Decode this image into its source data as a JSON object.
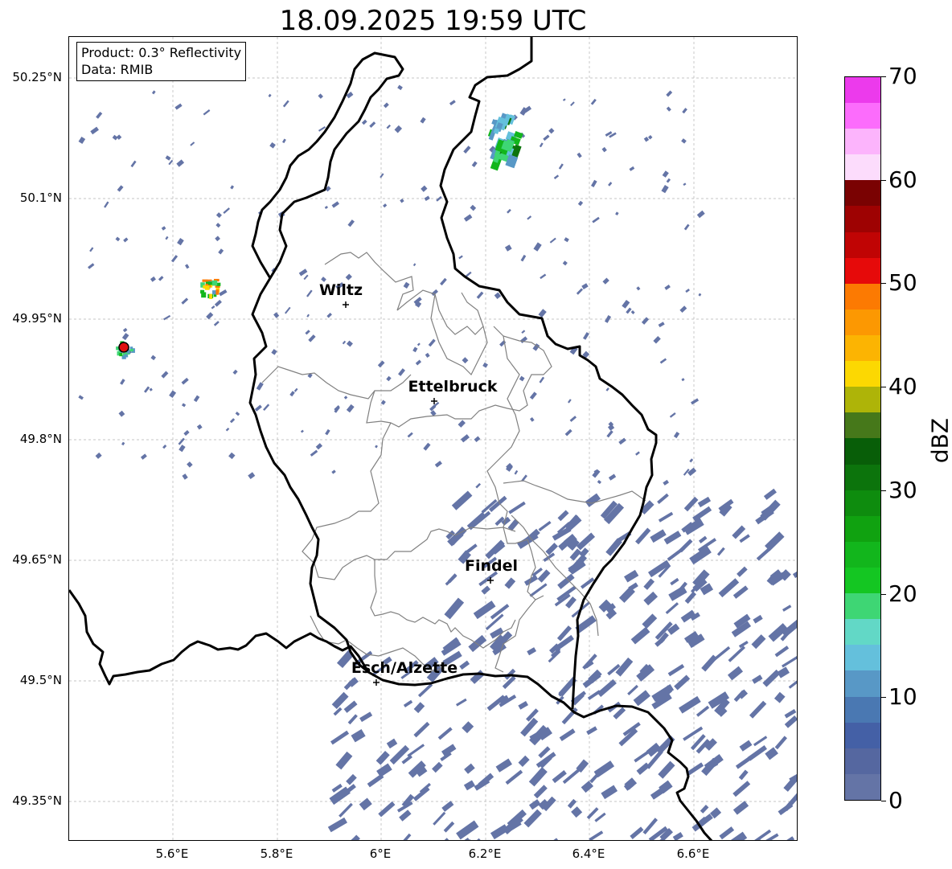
{
  "title": "18.09.2025 19:59 UTC",
  "info": {
    "product": "Product: 0.3° Reflectivity",
    "data": "Data: RMIB"
  },
  "latitude_labels": [
    "50.25°N",
    "50.1°N",
    "49.95°N",
    "49.8°N",
    "49.65°N",
    "49.5°N",
    "49.35°N"
  ],
  "longitude_labels": [
    "5.6°E",
    "5.8°E",
    "6°E",
    "6.2°E",
    "6.4°E",
    "6.6°E"
  ],
  "cities": [
    {
      "name": "Wiltz"
    },
    {
      "name": "Ettelbruck"
    },
    {
      "name": "Findel"
    },
    {
      "name": "Esch/Alzette"
    }
  ],
  "colorbar": {
    "unit": "dBZ",
    "tick_labels": [
      "0",
      "10",
      "20",
      "30",
      "40",
      "50",
      "60",
      "70"
    ],
    "colors": [
      "#6474a6",
      "#5567a0",
      "#4460a6",
      "#4a78b2",
      "#5898c6",
      "#64c0dc",
      "#62d8c6",
      "#3ed674",
      "#14c622",
      "#12b61c",
      "#10a210",
      "#0e8c0e",
      "#0c740c",
      "#085e08",
      "#46781a",
      "#aeb408",
      "#fcd802",
      "#fcb402",
      "#fc9802",
      "#fc7a02",
      "#e60a0a",
      "#c00404",
      "#9e0202",
      "#7a0202",
      "#fcdcfc",
      "#fcb4fc",
      "#fc6cfc",
      "#ec3aec"
    ]
  },
  "radar_site_color": "#e01010"
}
